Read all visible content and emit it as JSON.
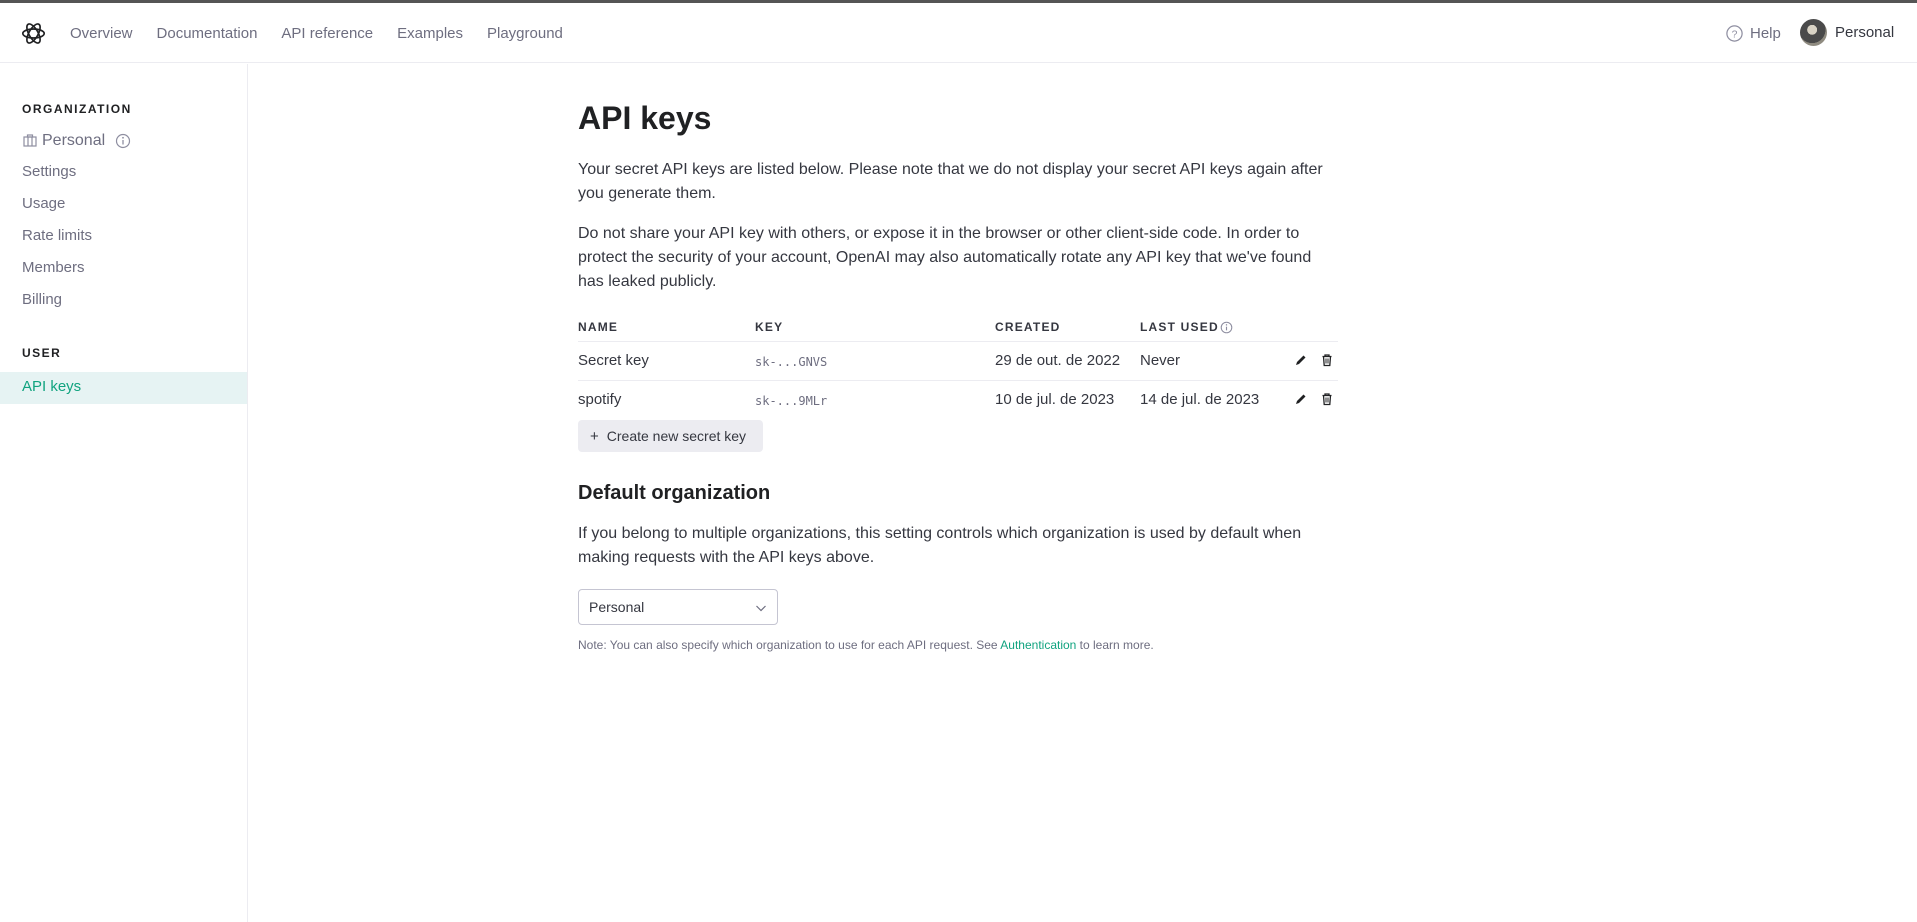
{
  "header": {
    "nav": [
      "Overview",
      "Documentation",
      "API reference",
      "Examples",
      "Playground"
    ],
    "help_label": "Help",
    "user_label": "Personal"
  },
  "sidebar": {
    "organization_title": "ORGANIZATION",
    "org_name": "Personal",
    "org_items": [
      "Settings",
      "Usage",
      "Rate limits",
      "Members",
      "Billing"
    ],
    "user_title": "USER",
    "active_item": "API keys"
  },
  "main": {
    "title": "API keys",
    "intro": "Your secret API keys are listed below. Please note that we do not display your secret API keys again after you generate them.",
    "warning": "Do not share your API key with others, or expose it in the browser or other client-side code. In order to protect the security of your account, OpenAI may also automatically rotate any API key that we've found has leaked publicly.",
    "table": {
      "headers": [
        "NAME",
        "KEY",
        "CREATED",
        "LAST USED"
      ],
      "rows": [
        {
          "name": "Secret key",
          "key": "sk-...GNVS",
          "created": "29 de out. de 2022",
          "last_used": "Never"
        },
        {
          "name": "spotify",
          "key": "sk-...9MLr",
          "created": "10 de jul. de 2023",
          "last_used": "14 de jul. de 2023"
        }
      ]
    },
    "create_button": "Create new secret key",
    "default_org": {
      "title": "Default organization",
      "description": "If you belong to multiple organizations, this setting controls which organization is used by default when making requests with the API keys above.",
      "selected": "Personal",
      "note_prefix": "Note: You can also specify which organization to use for each API request. See ",
      "note_link": "Authentication",
      "note_suffix": " to learn more."
    }
  },
  "colors": {
    "accent": "#10a37f",
    "active_bg": "#e6f3f3"
  },
  "icons": [
    "openai-logo-icon",
    "help-icon",
    "building-icon",
    "info-icon",
    "edit-icon",
    "trash-icon",
    "chevron-down-icon",
    "plus-icon"
  ]
}
